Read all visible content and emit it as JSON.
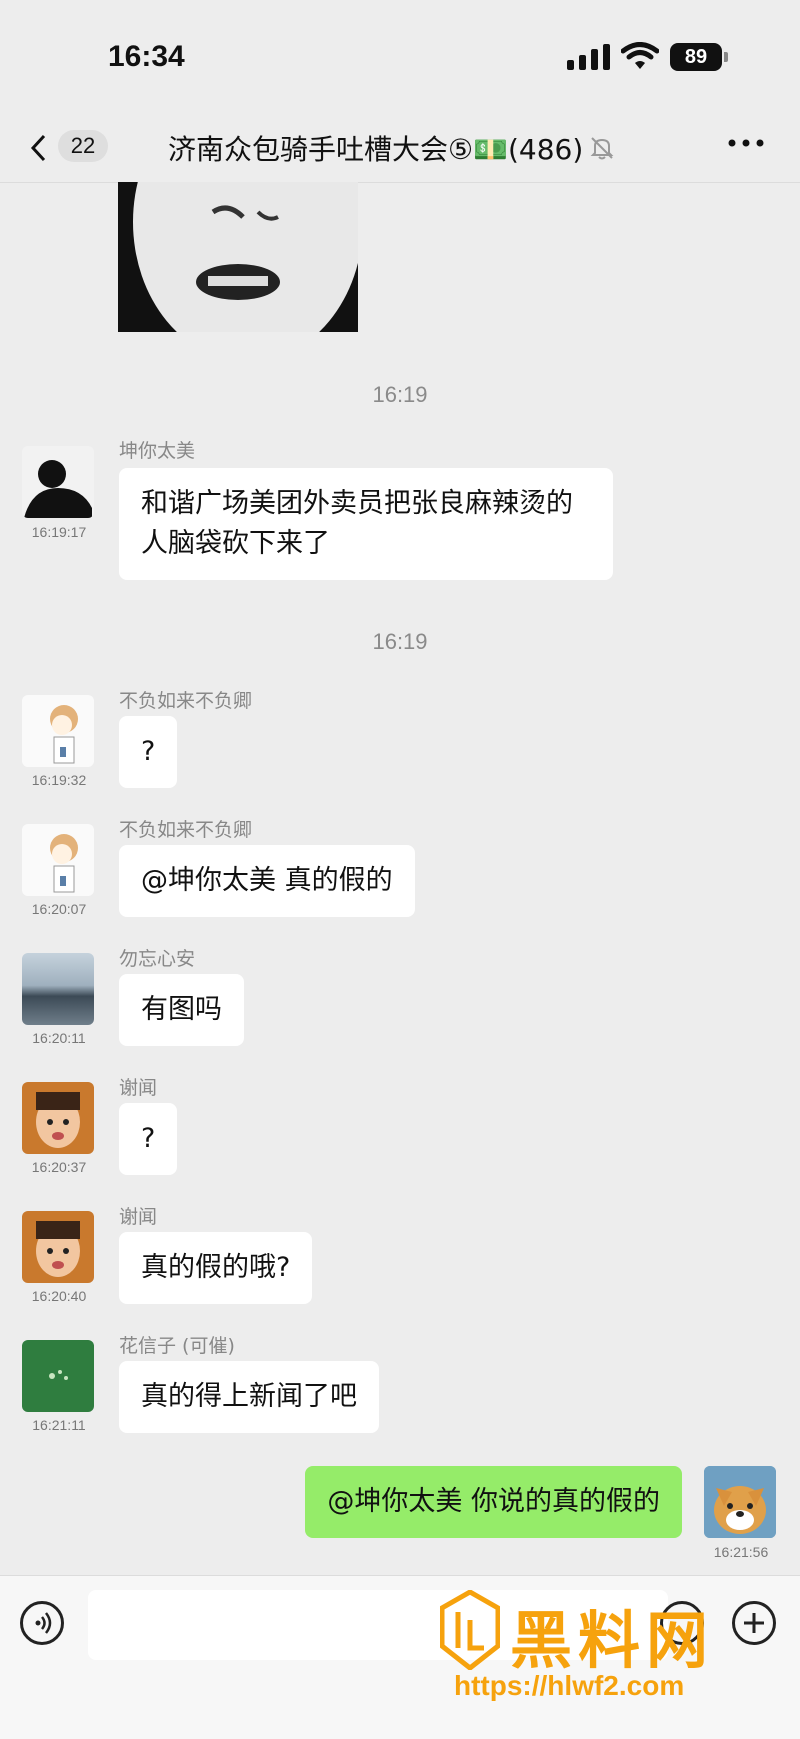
{
  "status": {
    "time": "16:34",
    "battery": "89"
  },
  "nav": {
    "unread": "22",
    "title": "济南众包骑手吐槽大会⑤💵(486)"
  },
  "timestamps": [
    "16:19",
    "16:19"
  ],
  "messages": [
    {
      "sender": "坤你太美",
      "time": "16:19:17",
      "text": "和谐广场美团外卖员把张良麻辣烫的人脑袋砍下来了"
    },
    {
      "sender": "不负如来不负卿",
      "time": "16:19:32",
      "text": "?"
    },
    {
      "sender": "不负如来不负卿",
      "time": "16:20:07",
      "text": "@坤你太美 真的假的"
    },
    {
      "sender": "勿忘心安",
      "time": "16:20:11",
      "text": "有图吗"
    },
    {
      "sender": "谢闻",
      "time": "16:20:37",
      "text": "?"
    },
    {
      "sender": "谢闻",
      "time": "16:20:40",
      "text": "真的假的哦?"
    },
    {
      "sender": "花信子 (可催)",
      "time": "16:21:11",
      "text": "真的得上新闻了吧"
    }
  ],
  "my_message": {
    "time": "16:21:56",
    "text": "@坤你太美 你说的真的假的"
  },
  "watermark": {
    "title": "黑料网",
    "url": "https://hlwf2.com"
  },
  "colors": {
    "background": "#ededed",
    "my_bubble": "#95ec69",
    "watermark": "#f6a20d"
  }
}
